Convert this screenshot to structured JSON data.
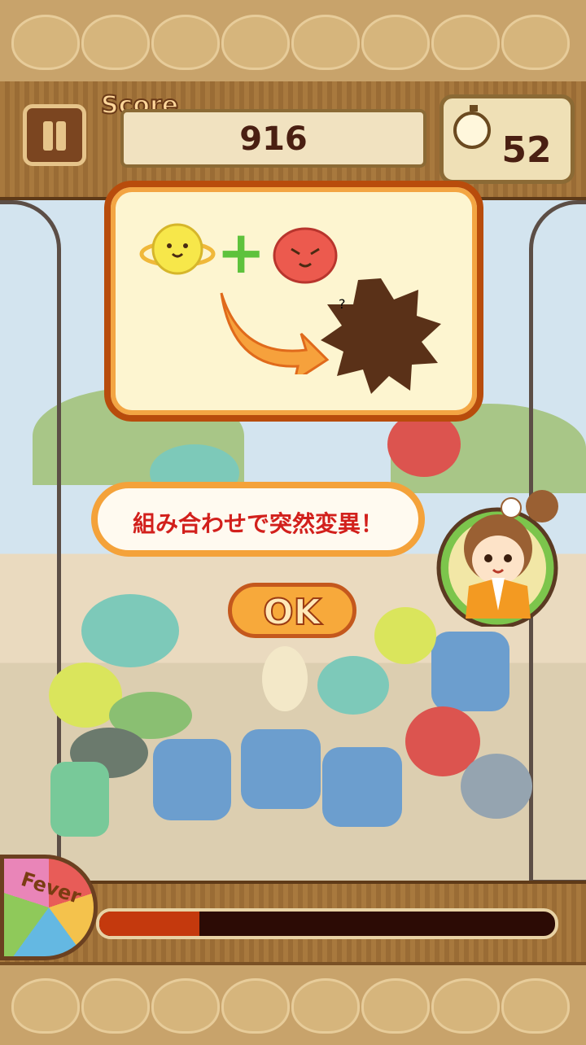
{
  "header": {
    "score_label": "Score",
    "score": "916",
    "time_remaining": "52"
  },
  "tutorial": {
    "result_symbol": "?",
    "message": "組み合わせで突然変異！",
    "ok_label": "OK"
  },
  "fever": {
    "label": "Fever",
    "progress": 0.22
  },
  "colors": {
    "accent": "#f4a23a",
    "border": "#b84c0c",
    "plus": "#5ec23c",
    "message": "#d2201c"
  }
}
